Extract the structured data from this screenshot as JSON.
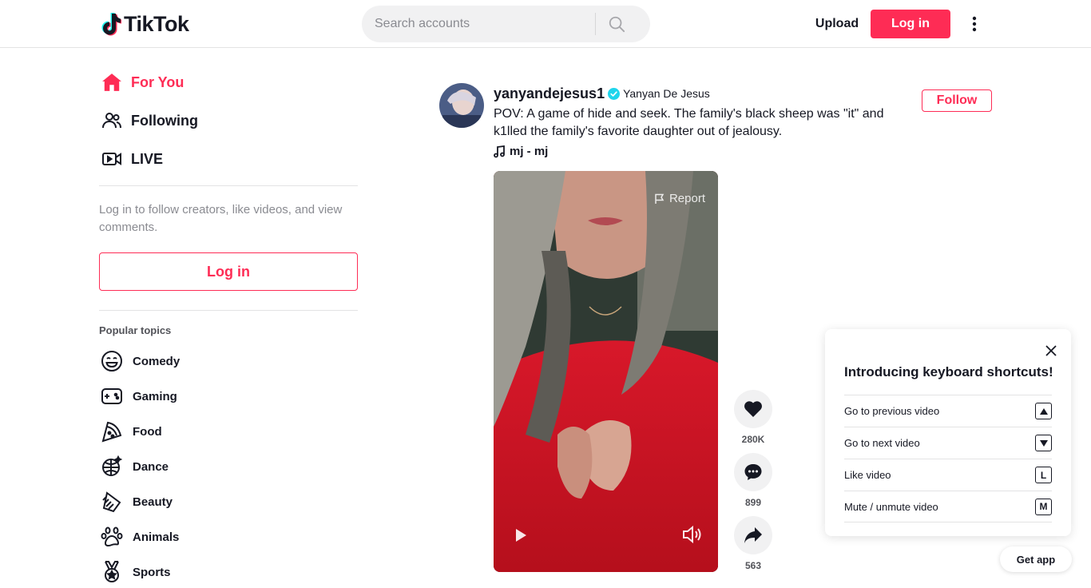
{
  "colors": {
    "brand": "#fe2c55",
    "text": "#161823",
    "muted": "#8a8b91",
    "verified": "#20d5ec"
  },
  "header": {
    "logo_text": "TikTok",
    "search_placeholder": "Search accounts",
    "upload_label": "Upload",
    "login_label": "Log in"
  },
  "sidebar": {
    "nav": [
      {
        "label": "For You",
        "icon": "home-icon"
      },
      {
        "label": "Following",
        "icon": "people-icon"
      },
      {
        "label": "LIVE",
        "icon": "live-icon"
      }
    ],
    "login_prompt": "Log in to follow creators, like videos, and view comments.",
    "login_button": "Log in",
    "topics_title": "Popular topics",
    "topics": [
      {
        "label": "Comedy",
        "icon": "smile-icon"
      },
      {
        "label": "Gaming",
        "icon": "gamepad-icon"
      },
      {
        "label": "Food",
        "icon": "pizza-icon"
      },
      {
        "label": "Dance",
        "icon": "disco-ball-icon"
      },
      {
        "label": "Beauty",
        "icon": "comb-icon"
      },
      {
        "label": "Animals",
        "icon": "paw-icon"
      },
      {
        "label": "Sports",
        "icon": "medal-icon"
      }
    ]
  },
  "post": {
    "username": "yanyandejesus1",
    "nickname": "Yanyan De Jesus",
    "description": "POV: A game of hide and seek. The family's black sheep was \"it\" and k1lled the family's favorite daughter out of jealousy.",
    "music": "mj - mj",
    "follow_label": "Follow",
    "report_label": "Report",
    "likes": "280K",
    "comments": "899",
    "shares": "563"
  },
  "shortcuts": {
    "title": "Introducing keyboard shortcuts!",
    "items": [
      {
        "label": "Go to previous video",
        "key": "▲"
      },
      {
        "label": "Go to next video",
        "key": "▼"
      },
      {
        "label": "Like video",
        "key": "L"
      },
      {
        "label": "Mute / unmute video",
        "key": "M"
      }
    ]
  },
  "get_app_label": "Get app"
}
